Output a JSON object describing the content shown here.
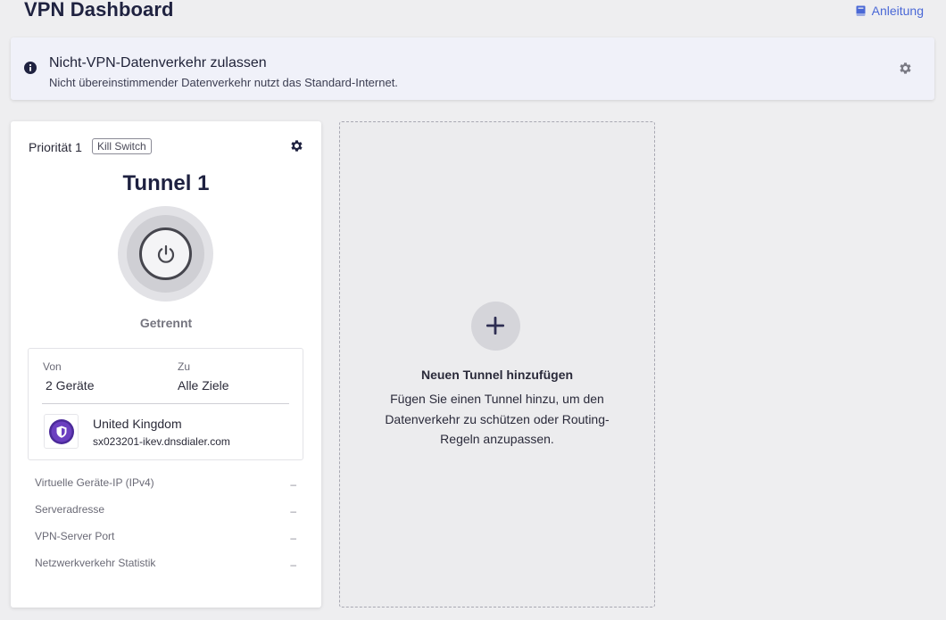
{
  "header": {
    "title": "VPN Dashboard",
    "guide_label": "Anleitung"
  },
  "banner": {
    "title": "Nicht-VPN-Datenverkehr zulassen",
    "subtitle": "Nicht übereinstimmender Datenverkehr nutzt das Standard-Internet."
  },
  "tunnel": {
    "priority": "Priorität 1",
    "kill_switch": "Kill Switch",
    "name": "Tunnel 1",
    "status": "Getrennt",
    "from_label": "Von",
    "from_value": "2 Geräte",
    "to_label": "Zu",
    "to_value": "Alle Ziele",
    "server_country": "United Kingdom",
    "server_host": "sx023201-ikev.dnsdialer.com",
    "stats": [
      {
        "label": "Virtuelle Geräte-IP (IPv4)",
        "value": "–"
      },
      {
        "label": "Serveradresse",
        "value": "–"
      },
      {
        "label": "VPN-Server Port",
        "value": "–"
      },
      {
        "label": "Netzwerkverkehr Statistik",
        "value": "–"
      }
    ]
  },
  "add_tunnel": {
    "title": "Neuen Tunnel hinzufügen",
    "description": "Fügen Sie einen Tunnel hinzu, um den Datenverkehr zu schützen oder Routing-Regeln anzupassen."
  },
  "colors": {
    "accent": "#4a68d6",
    "background": "#eeeef0",
    "banner_bg": "#f0f1f9",
    "shield_purple": "#4b2a9a"
  },
  "icons": [
    "book-icon",
    "info-icon",
    "gear-icon",
    "power-icon",
    "shield-icon",
    "plus-icon"
  ]
}
